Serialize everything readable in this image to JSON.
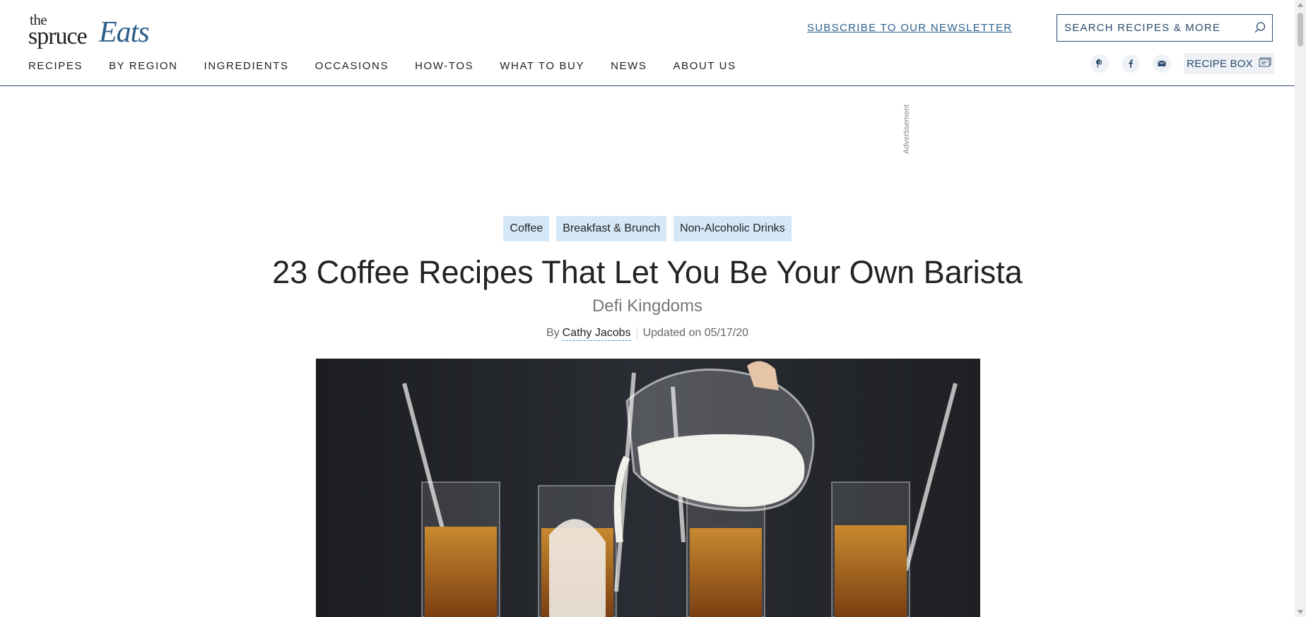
{
  "header": {
    "logo": {
      "the": "the",
      "spruce": "spruce",
      "eats": "Eats"
    },
    "nav": [
      {
        "label": "RECIPES"
      },
      {
        "label": "BY REGION"
      },
      {
        "label": "INGREDIENTS"
      },
      {
        "label": "OCCASIONS"
      },
      {
        "label": "HOW-TOS"
      },
      {
        "label": "WHAT TO BUY"
      },
      {
        "label": "NEWS"
      },
      {
        "label": "ABOUT US"
      }
    ],
    "newsletter_link": "SUBSCRIBE TO OUR NEWSLETTER",
    "search": {
      "placeholder": "SEARCH RECIPES & MORE",
      "icon": "search-icon"
    },
    "social": [
      {
        "icon": "pinterest-icon"
      },
      {
        "icon": "facebook-icon"
      },
      {
        "icon": "email-icon"
      }
    ],
    "recipe_box": {
      "label": "RECIPE BOX",
      "icon": "recipe-box-icon"
    }
  },
  "ad": {
    "label": "Advertisement"
  },
  "article": {
    "tags": [
      "Coffee",
      "Breakfast & Brunch",
      "Non-Alcoholic Drinks"
    ],
    "title": "23 Coffee Recipes That Let You Be Your Own Barista",
    "subtitle": "Defi Kingdoms",
    "byline": {
      "by": "By",
      "author": "Cathy Jacobs",
      "updated": "Updated on 05/17/20"
    }
  },
  "colors": {
    "brand_blue": "#2d5f8b",
    "header_border": "#2d4b6b",
    "tag_background": "#d5e8f8",
    "hero_background": "#22252a"
  }
}
